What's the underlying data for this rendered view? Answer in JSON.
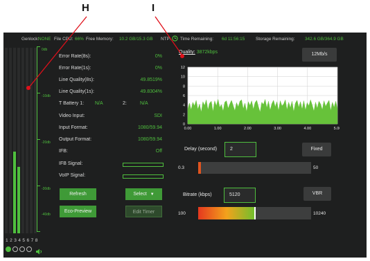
{
  "callouts": {
    "h": "H",
    "i": "I"
  },
  "status_bar": {
    "genlock_label": "Genlock:",
    "genlock_value": "NONE",
    "cpu_label": "File CPU:",
    "cpu_value": "66%",
    "mem_label": "Free Memory:",
    "mem_value": "10.2 GB/15.3 GB",
    "ntp_label": "NTP:",
    "time_label": "Time Remaining:",
    "time_value": "6d 11:56:15",
    "storage_label": "Storage Remaining:",
    "storage_value": "342.6 GB/364.9 GB"
  },
  "audio_meters": {
    "scale_labels": [
      "0db",
      "-10db",
      "-20db",
      "-30db",
      "-40db"
    ],
    "channel_numbers": "1 2 3 4 5 6 7 8",
    "levels": [
      0.0,
      0.0,
      0.44,
      0.36,
      0.0,
      0.0,
      0.0,
      0.0
    ]
  },
  "stats": [
    {
      "label": "Error Rate(8s):",
      "value": "0%"
    },
    {
      "label": "Error Rate(1s):",
      "value": "0%"
    },
    {
      "label": "Line Quality(8s):",
      "value": "49.8519%"
    },
    {
      "label": "Line Quality(1s):",
      "value": "49.8304%"
    }
  ],
  "battery": {
    "label1": "T Battery 1:",
    "value1": "N/A",
    "label2": "2:",
    "value2": "N/A"
  },
  "stats2": [
    {
      "label": "Video Input:",
      "value": "SDI"
    },
    {
      "label": "Input Format:",
      "value": "1080/59.94"
    },
    {
      "label": "Output Format:",
      "value": "1080/59.94"
    },
    {
      "label": "IFB:",
      "value": "Off"
    },
    {
      "label": "IFB Signal:"
    },
    {
      "label": "VoIP Signal:"
    }
  ],
  "buttons": {
    "refresh": "Refresh",
    "select": "Select",
    "eco": "Eco-Preview",
    "edit_timer": "Edit Timer"
  },
  "quality": {
    "label": "Quality:",
    "value": "3872kbps",
    "rate_button": "12Mb/s"
  },
  "chart_data": {
    "type": "area",
    "x_ticks": [
      "0.00",
      "1.00",
      "2.00",
      "3.00",
      "4.00",
      "5.00"
    ],
    "y_ticks": [
      "0",
      "2",
      "4",
      "6",
      "8",
      "10",
      "12"
    ],
    "xlim": [
      0,
      5
    ],
    "ylim": [
      0,
      12
    ],
    "grid": true,
    "color": "#67c23a",
    "values": [
      3.1,
      4.4,
      3.0,
      4.6,
      3.8,
      5.0,
      3.1,
      4.2,
      2.5,
      4.7,
      3.9,
      5.1,
      3.0,
      4.4,
      4.8,
      2.6,
      4.9,
      3.8,
      5.2,
      3.5,
      4.1,
      2.7,
      4.6,
      4.9,
      3.3,
      4.2,
      5.0,
      3.9,
      2.8,
      4.5,
      3.6,
      4.8,
      5.1,
      3.2,
      4.4,
      2.6,
      4.7,
      3.9,
      4.9,
      3.1,
      4.5,
      5.0,
      3.7,
      2.5,
      4.6,
      4.1,
      5.2,
      3.4,
      4.8,
      2.9,
      4.3,
      5.0,
      3.6,
      4.7,
      2.8,
      4.9,
      3.8,
      4.2,
      5.1,
      3.0,
      4.6,
      3.4,
      4.8,
      2.6,
      4.4,
      5.0,
      3.5,
      4.7,
      3.1,
      4.9,
      2.9,
      4.5,
      3.8,
      5.1,
      4.0,
      2.7,
      4.6,
      3.3,
      4.8,
      4.2,
      3.0,
      4.9,
      3.7,
      4.4,
      5.0,
      2.8,
      4.6,
      3.5,
      4.8,
      3.2
    ]
  },
  "delay": {
    "label": "Delay (second)",
    "value": "2",
    "button": "Fixed",
    "min": "0.3",
    "max": "50",
    "position": 0.0
  },
  "bitrate": {
    "label": "Bitrate (kbps)",
    "value": "5120",
    "button": "VBR",
    "min": "100",
    "max": "10240",
    "position": 0.5
  }
}
